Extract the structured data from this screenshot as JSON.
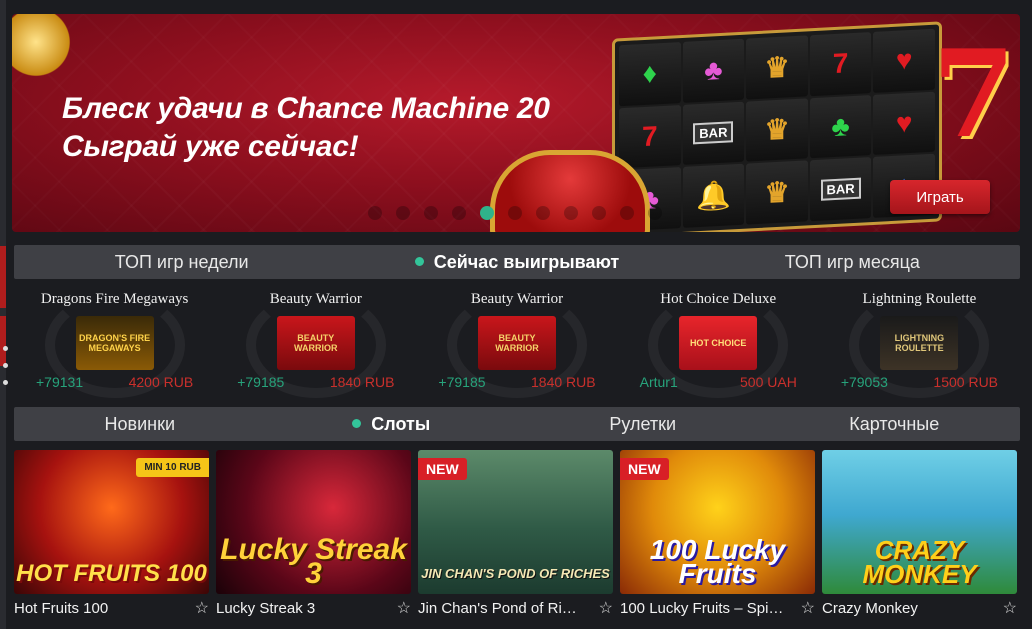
{
  "banner": {
    "title_line1": "Блеск удачи в Chance Machine 20",
    "title_line2": "Сыграй уже сейчас!",
    "play_button": "Играть",
    "bar_symbol": "BAR",
    "slides_total": 11,
    "active_slide": 5
  },
  "tabs_top": [
    {
      "label": "ТОП игр недели"
    },
    {
      "label": "Сейчас выигрывают"
    },
    {
      "label": "ТОП игр месяца"
    }
  ],
  "winners": [
    {
      "game": "Dragons Fire Megaways",
      "thumb": "DRAGON'S FIRE MEGAWAYS",
      "user": "+79131",
      "amount": "4200 RUB"
    },
    {
      "game": "Beauty Warrior",
      "thumb": "BEAUTY WARRIOR",
      "user": "+79185",
      "amount": "1840 RUB"
    },
    {
      "game": "Beauty Warrior",
      "thumb": "BEAUTY WARRIOR",
      "user": "+79185",
      "amount": "1840 RUB"
    },
    {
      "game": "Hot Choice Deluxe",
      "thumb": "HOT CHOICE",
      "user": "Artur1",
      "amount": "500 UAH"
    },
    {
      "game": "Lightning Roulette",
      "thumb": "LIGHTNING ROULETTE",
      "user": "+79053",
      "amount": "1500 RUB"
    }
  ],
  "tabs_games": [
    {
      "label": "Новинки"
    },
    {
      "label": "Слоты"
    },
    {
      "label": "Рулетки"
    },
    {
      "label": "Карточные"
    }
  ],
  "games": [
    {
      "name": "Hot Fruits 100",
      "art": "HOT FRUITS 100",
      "badge": "MIN 10 RUB"
    },
    {
      "name": "Lucky Streak 3",
      "art": "Lucky Streak 3",
      "badge": ""
    },
    {
      "name": "Jin Chan's Pond of Ric…",
      "art": "JIN CHAN'S POND OF RICHES",
      "badge": "NEW"
    },
    {
      "name": "100 Lucky Fruits – Spi…",
      "art": "100 Lucky Fruits",
      "badge": "NEW"
    },
    {
      "name": "Crazy Monkey",
      "art": "CRAZY MONKEY",
      "badge": ""
    }
  ],
  "icons": {
    "favorite": "star-outline-icon"
  },
  "colors": {
    "accent_green": "#33c59a",
    "accent_red": "#d7262c",
    "tab_bg": "#3f4045"
  }
}
